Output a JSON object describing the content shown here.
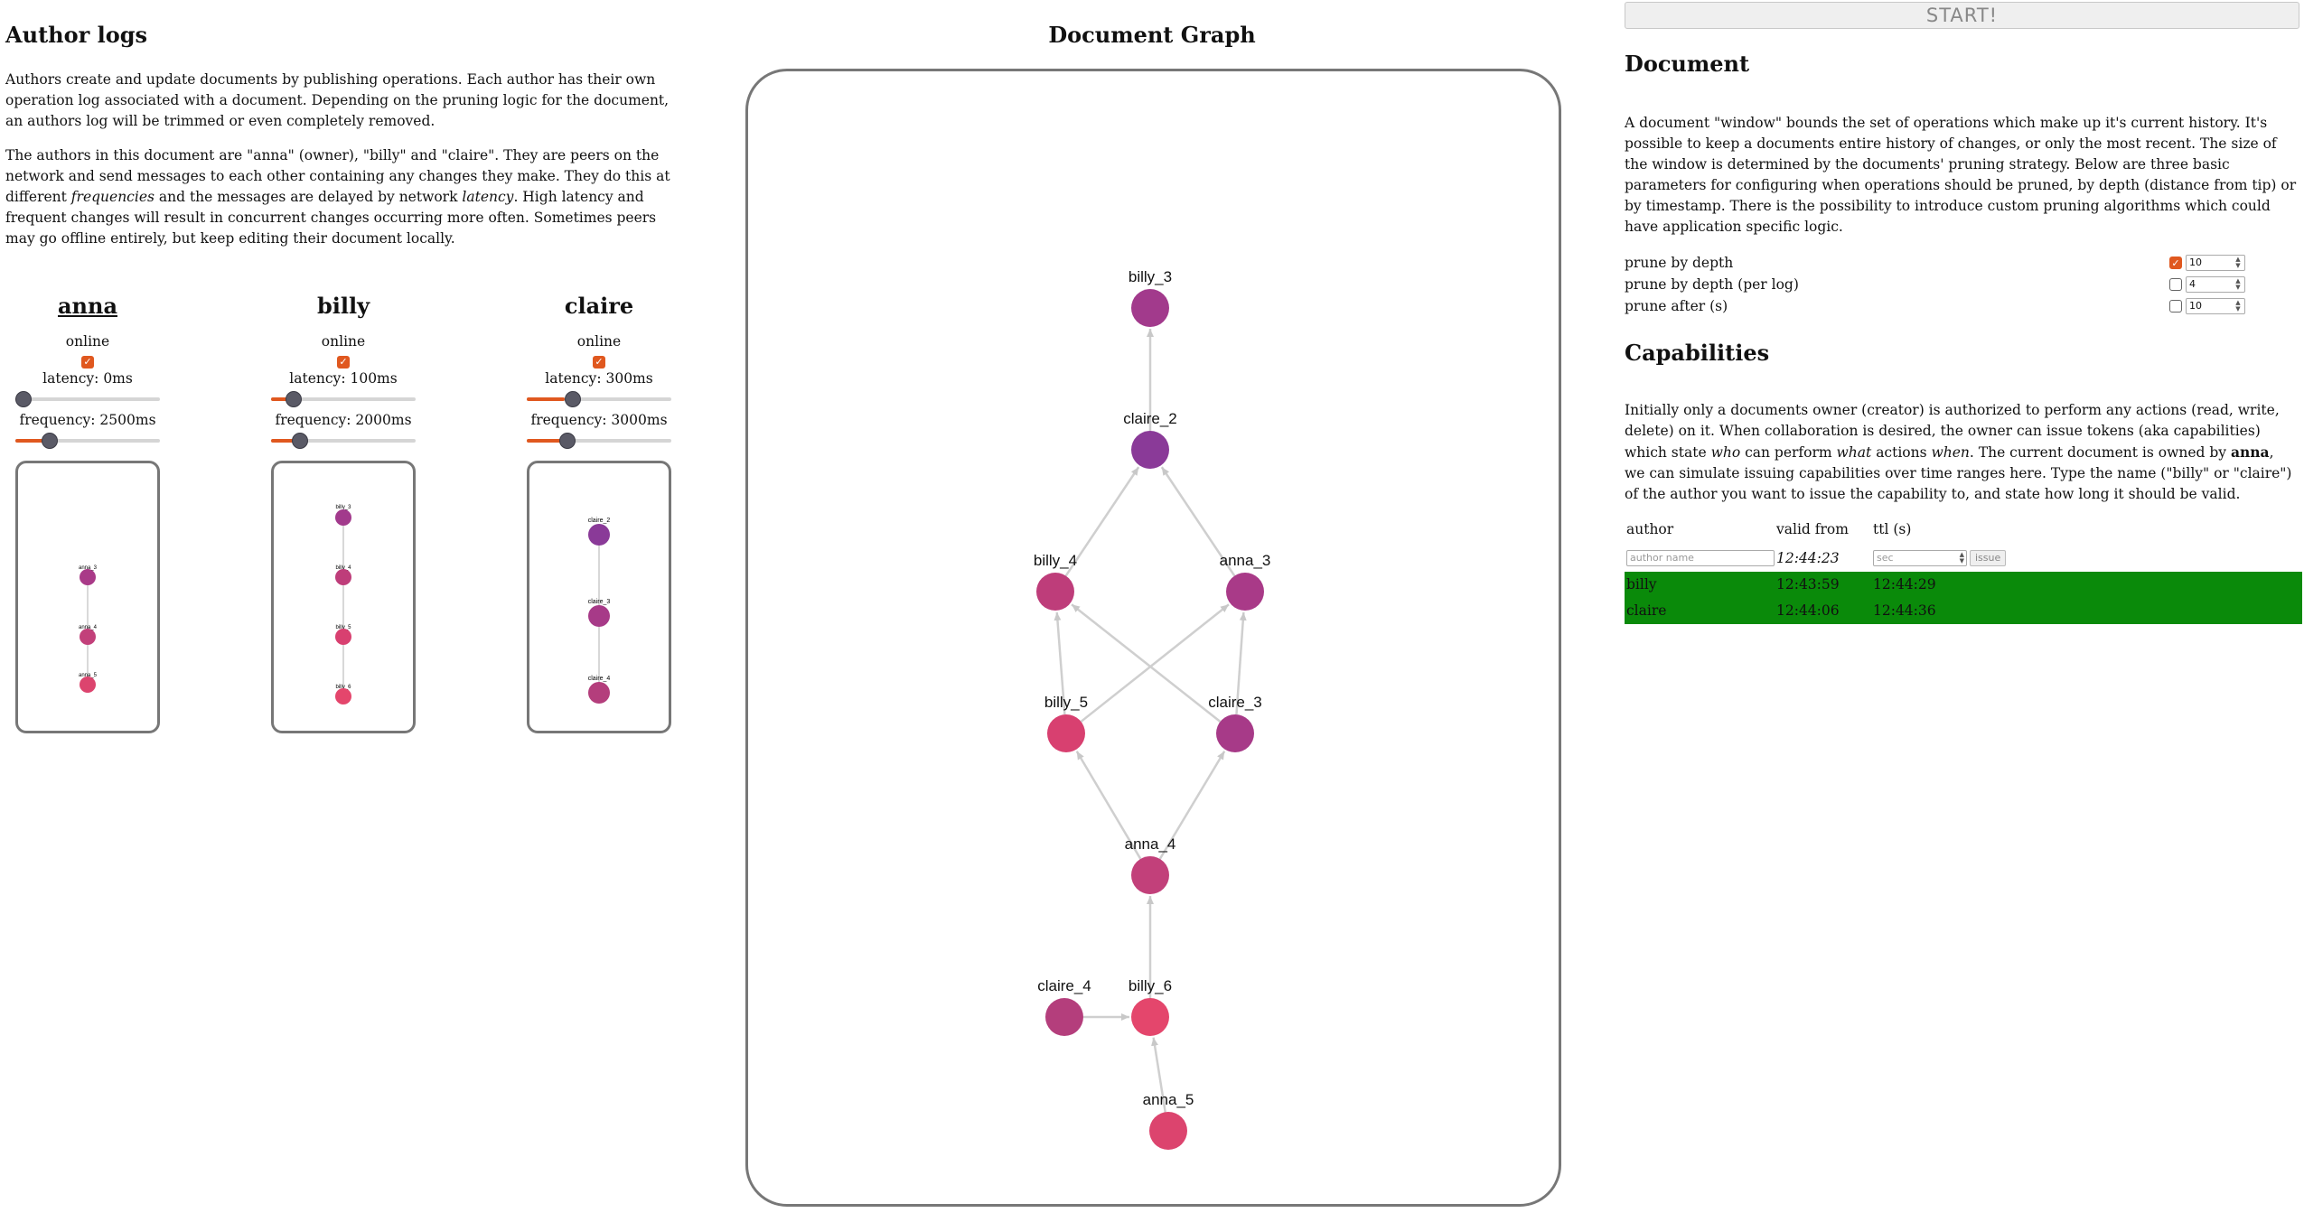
{
  "left": {
    "title": "Author logs",
    "intro_1": "Authors create and update documents by publishing operations. Each author has their own operation log associated with a document. Depending on the pruning logic for the document, an authors log will be trimmed or even completely removed.",
    "intro_2_part1": "The authors in this document are \"anna\" (owner), \"billy\" and \"claire\". They are peers on the network and send messages to each other containing any changes they make. They do this at different ",
    "intro_2_em1": "frequencies",
    "intro_2_part2": " and the messages are delayed by network ",
    "intro_2_em2": "latency",
    "intro_2_part3": ". High latency and frequent changes will result in concurrent changes occurring more often. Sometimes peers may go offline entirely, but keep editing their document locally."
  },
  "authors": [
    {
      "name": "anna",
      "online_label": "online",
      "online": true,
      "latency_label": "latency: 0ms",
      "latency_ms": 0,
      "frequency_label": "frequency: 2500ms",
      "frequency_ms": 2500,
      "log": [
        "anna_3",
        "anna_4",
        "anna_5"
      ]
    },
    {
      "name": "billy",
      "online_label": "online",
      "online": true,
      "latency_label": "latency: 100ms",
      "latency_ms": 100,
      "frequency_label": "frequency: 2000ms",
      "frequency_ms": 2000,
      "log": [
        "billy_3",
        "billy_4",
        "billy_5",
        "billy_6"
      ]
    },
    {
      "name": "claire",
      "online_label": "online",
      "online": true,
      "latency_label": "latency: 300ms",
      "latency_ms": 300,
      "frequency_label": "frequency: 3000ms",
      "frequency_ms": 3000,
      "log": [
        "claire_2",
        "claire_3",
        "claire_4"
      ]
    }
  ],
  "graph": {
    "title": "Document Graph",
    "nodes": [
      "billy_3",
      "claire_2",
      "billy_4",
      "anna_3",
      "billy_5",
      "claire_3",
      "anna_4",
      "claire_4",
      "billy_6",
      "anna_5"
    ],
    "edges": [
      [
        "claire_2",
        "billy_3"
      ],
      [
        "billy_4",
        "claire_2"
      ],
      [
        "anna_3",
        "claire_2"
      ],
      [
        "billy_5",
        "billy_4"
      ],
      [
        "billy_5",
        "anna_3"
      ],
      [
        "claire_3",
        "billy_4"
      ],
      [
        "claire_3",
        "anna_3"
      ],
      [
        "anna_4",
        "billy_5"
      ],
      [
        "anna_4",
        "claire_3"
      ],
      [
        "billy_6",
        "anna_4"
      ],
      [
        "claire_4",
        "billy_6"
      ],
      [
        "anna_5",
        "billy_6"
      ]
    ]
  },
  "right": {
    "start_label": "START!",
    "document_title": "Document",
    "document_para": "A document \"window\" bounds the set of operations which make up it's current history. It's possible to keep a documents entire history of changes, or only the most recent. The size of the window is determined by the documents' pruning strategy. Below are three basic parameters for configuring when operations should be pruned, by depth (distance from tip) or by timestamp. There is the possibility to introduce custom pruning algorithms which could have application specific logic.",
    "prune": [
      {
        "label": "prune by depth",
        "checked": true,
        "value": "10"
      },
      {
        "label": "prune by depth (per log)",
        "checked": false,
        "value": "4"
      },
      {
        "label": "prune after (s)",
        "checked": false,
        "value": "10"
      }
    ],
    "capabilities_title": "Capabilities",
    "cap_para_1": "Initially only a documents owner (creator) is authorized to perform any actions (read, write, delete) on it. When collaboration is desired, the owner can issue tokens (aka capabilities) which state ",
    "cap_para_em_who": "who",
    "cap_para_2": " can perform ",
    "cap_para_em_what": "what",
    "cap_para_3": " actions ",
    "cap_para_em_when": "when",
    "cap_para_4": ". The current document is owned by ",
    "cap_para_owner": "anna",
    "cap_para_5": ", we can simulate issuing capabilities over time ranges here. Type the name (\"billy\" or \"claire\") of the author you want to issue the capability to, and state how long it should be valid.",
    "table_headers": {
      "author": "author",
      "valid_from": "valid from",
      "ttl": "ttl (s)"
    },
    "author_placeholder": "author name",
    "current_time": "12:44:23",
    "ttl_placeholder": "sec",
    "issue_label": "issue",
    "rows": [
      {
        "author": "billy",
        "valid_from": "12:43:59",
        "ttl": "12:44:29"
      },
      {
        "author": "claire",
        "valid_from": "12:44:06",
        "ttl": "12:44:36"
      }
    ],
    "row_color": "#0a8a0a"
  },
  "colors": {
    "accent": "#e0581f",
    "node_billy_3": "#a23a8c",
    "node_claire_2": "#8a3a98",
    "node_billy_4": "#be3d7a",
    "node_anna_3": "#a93a88",
    "node_billy_5": "#d84070",
    "node_claire_3": "#a73a88",
    "node_anna_4": "#c2407a",
    "node_claire_4": "#b43e7c",
    "node_billy_6": "#e4466c",
    "node_anna_5": "#dc446e"
  }
}
